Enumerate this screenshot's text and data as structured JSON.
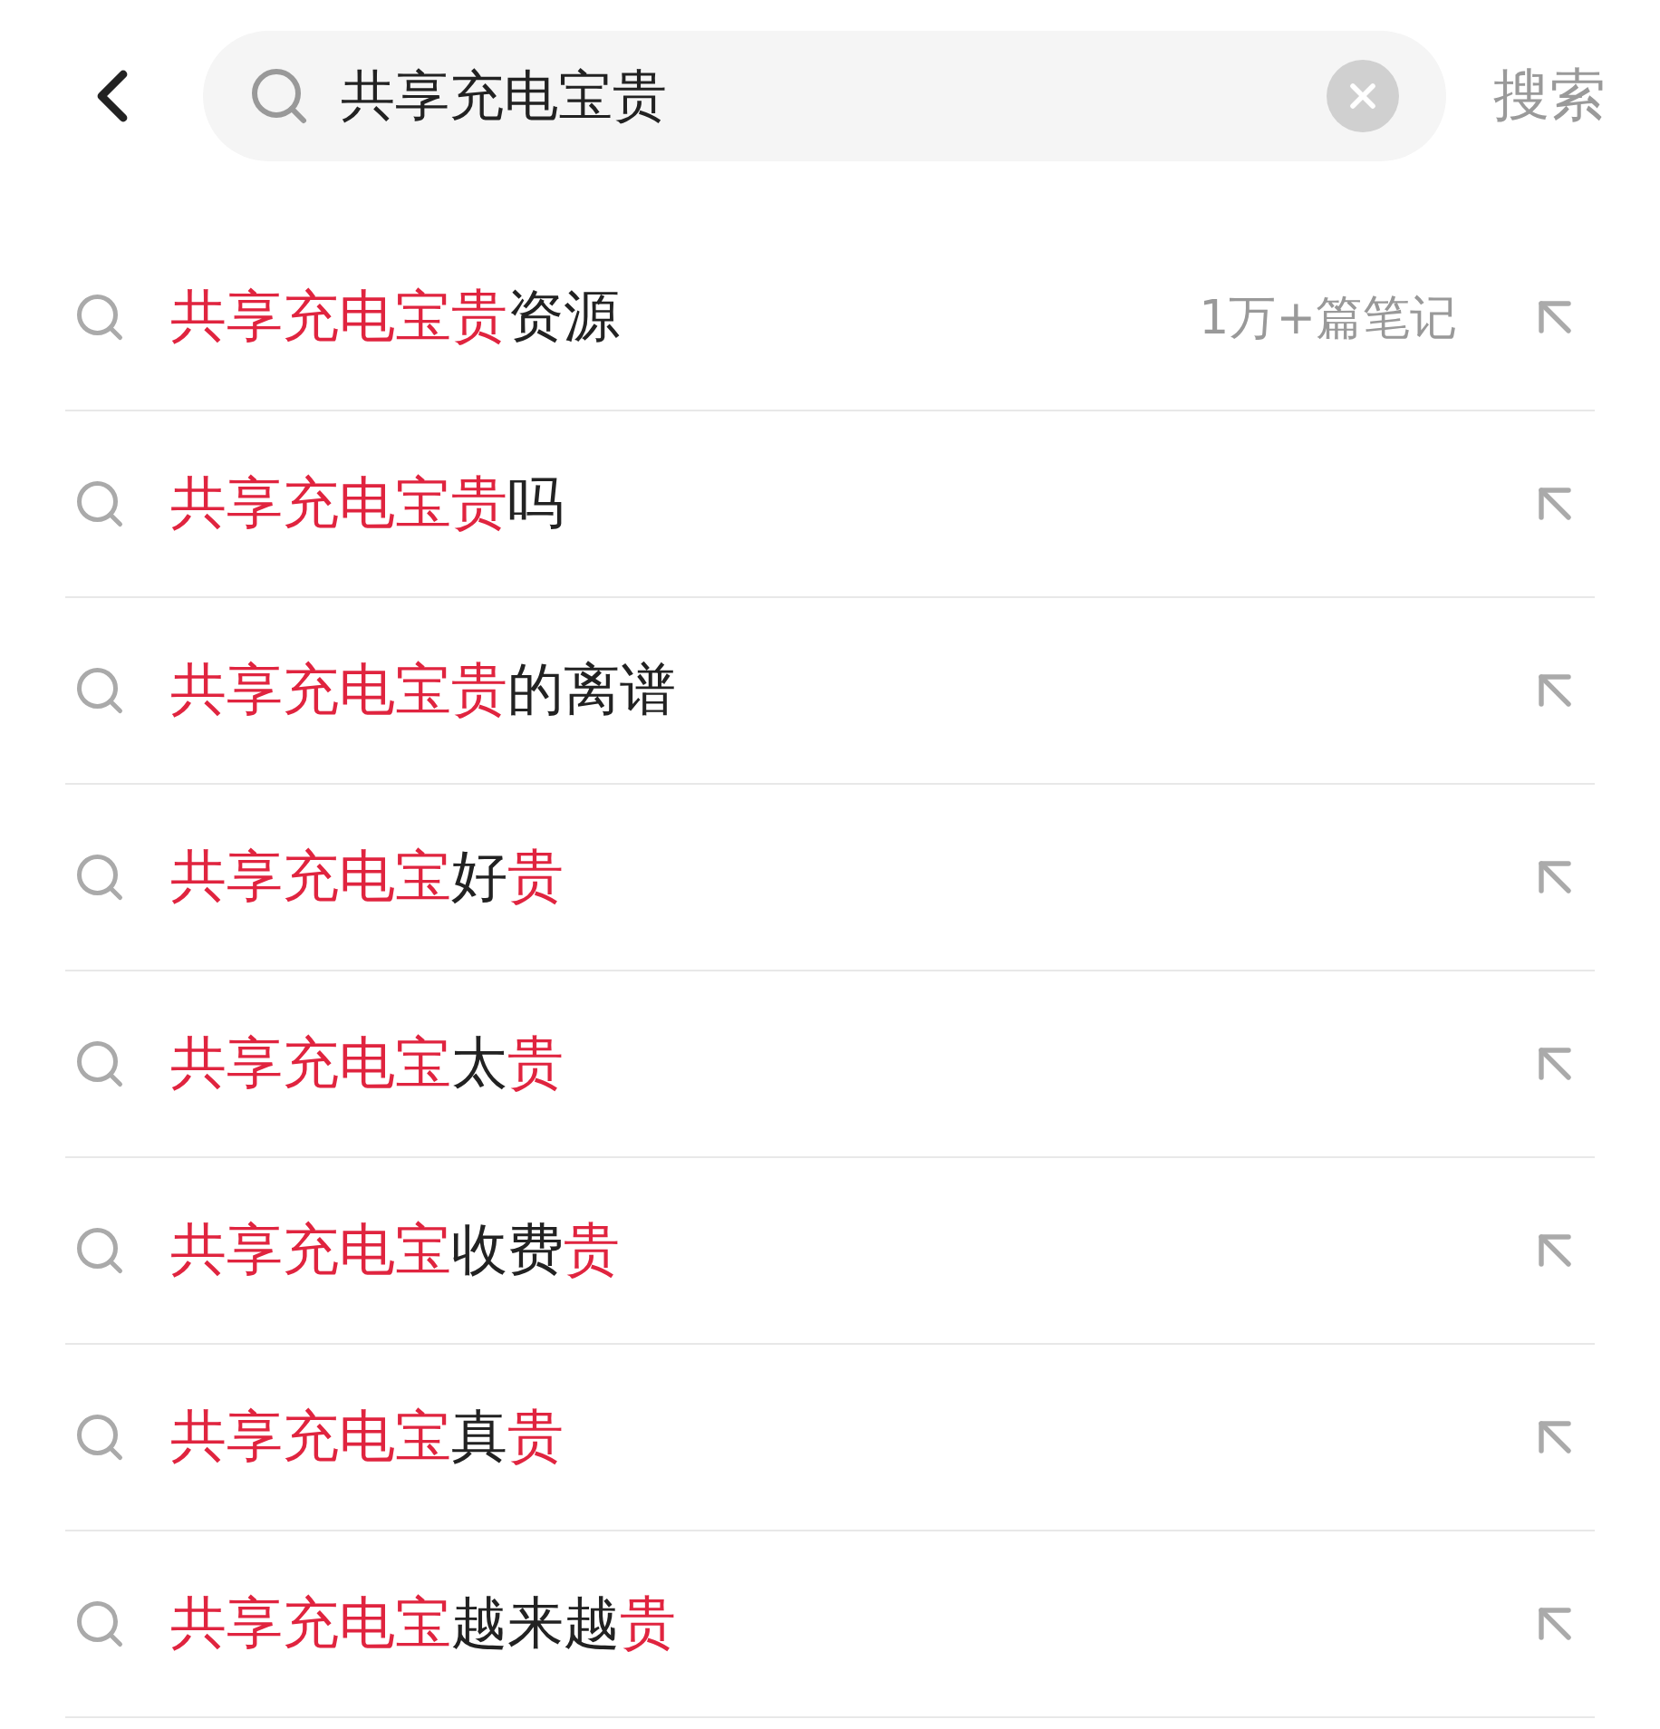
{
  "search_bar": {
    "value": "共享充电宝贵",
    "submit": "搜索"
  },
  "suggestions": [
    {
      "segments": [
        {
          "text": "共享充电宝贵",
          "highlight": true
        },
        {
          "text": "资源",
          "highlight": false
        }
      ],
      "count": "1万+篇笔记"
    },
    {
      "segments": [
        {
          "text": "共享充电宝贵",
          "highlight": true
        },
        {
          "text": "吗",
          "highlight": false
        }
      ]
    },
    {
      "segments": [
        {
          "text": "共享充电宝贵",
          "highlight": true
        },
        {
          "text": "的离谱",
          "highlight": false
        }
      ]
    },
    {
      "segments": [
        {
          "text": "共享充电宝",
          "highlight": true
        },
        {
          "text": "好",
          "highlight": false
        },
        {
          "text": "贵",
          "highlight": true
        }
      ]
    },
    {
      "segments": [
        {
          "text": "共享充电宝",
          "highlight": true
        },
        {
          "text": "太",
          "highlight": false
        },
        {
          "text": "贵",
          "highlight": true
        }
      ]
    },
    {
      "segments": [
        {
          "text": "共享充电宝",
          "highlight": true
        },
        {
          "text": "收费",
          "highlight": false
        },
        {
          "text": "贵",
          "highlight": true
        }
      ]
    },
    {
      "segments": [
        {
          "text": "共享充电宝",
          "highlight": true
        },
        {
          "text": "真",
          "highlight": false
        },
        {
          "text": "贵",
          "highlight": true
        }
      ]
    },
    {
      "segments": [
        {
          "text": "共享充电宝",
          "highlight": true
        },
        {
          "text": "越来越",
          "highlight": false
        },
        {
          "text": "贵",
          "highlight": true
        }
      ]
    }
  ]
}
